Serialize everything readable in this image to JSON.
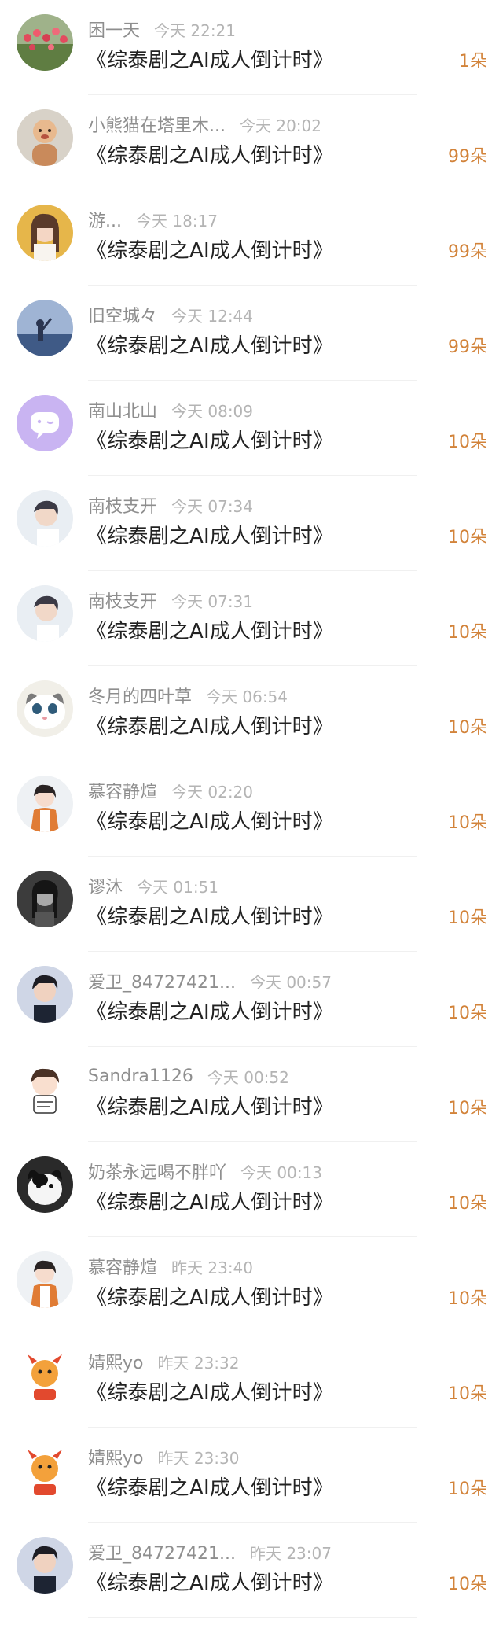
{
  "colors": {
    "name": "#8e8e8e",
    "time": "#b4b4b4",
    "title": "#222222",
    "count": "#d2833a",
    "divider": "#f0f0f0"
  },
  "rows": [
    {
      "name": "困一天",
      "time": "今天 22:21",
      "title": "《综泰剧之AI成人倒计时》",
      "count": "1朵",
      "avatar": "flowers-avatar"
    },
    {
      "name": "小熊猫在塔里木...",
      "time": "今天 20:02",
      "title": "《综泰剧之AI成人倒计时》",
      "count": "99朵",
      "avatar": "child-avatar"
    },
    {
      "name": "游...",
      "time": "今天 18:17",
      "title": "《综泰剧之AI成人倒计时》",
      "count": "99朵",
      "avatar": "girl-avatar"
    },
    {
      "name": "旧空城々",
      "time": "今天 12:44",
      "title": "《综泰剧之AI成人倒计时》",
      "count": "99朵",
      "avatar": "sky-avatar"
    },
    {
      "name": "南山北山",
      "time": "今天 08:09",
      "title": "《综泰剧之AI成人倒计时》",
      "count": "10朵",
      "avatar": "default-avatar"
    },
    {
      "name": "南枝支开",
      "time": "今天 07:34",
      "title": "《综泰剧之AI成人倒计时》",
      "count": "10朵",
      "avatar": "man-avatar"
    },
    {
      "name": "南枝支开",
      "time": "今天 07:31",
      "title": "《综泰剧之AI成人倒计时》",
      "count": "10朵",
      "avatar": "man-avatar"
    },
    {
      "name": "冬月的四叶草",
      "time": "今天 06:54",
      "title": "《综泰剧之AI成人倒计时》",
      "count": "10朵",
      "avatar": "cat-avatar"
    },
    {
      "name": "慕容静煊",
      "time": "今天 02:20",
      "title": "《综泰剧之AI成人倒计时》",
      "count": "10朵",
      "avatar": "winter-girl-avatar"
    },
    {
      "name": "谬沐",
      "time": "今天 01:51",
      "title": "《综泰剧之AI成人倒计时》",
      "count": "10朵",
      "avatar": "dark-portrait-avatar"
    },
    {
      "name": "爱卫_84727421...",
      "time": "今天 00:57",
      "title": "《综泰剧之AI成人倒计时》",
      "count": "10朵",
      "avatar": "young-man-avatar"
    },
    {
      "name": "Sandra1126",
      "time": "今天 00:52",
      "title": "《综泰剧之AI成人倒计时》",
      "count": "10朵",
      "avatar": "cartoon-boy-avatar"
    },
    {
      "name": "奶茶永远喝不胖吖",
      "time": "今天 00:13",
      "title": "《综泰剧之AI成人倒计时》",
      "count": "10朵",
      "avatar": "black-white-cat-avatar"
    },
    {
      "name": "慕容静煊",
      "time": "昨天 23:40",
      "title": "《综泰剧之AI成人倒计时》",
      "count": "10朵",
      "avatar": "winter-girl-avatar"
    },
    {
      "name": "婧熙yo",
      "time": "昨天 23:32",
      "title": "《综泰剧之AI成人倒计时》",
      "count": "10朵",
      "avatar": "dragon-avatar"
    },
    {
      "name": "婧熙yo",
      "time": "昨天 23:30",
      "title": "《综泰剧之AI成人倒计时》",
      "count": "10朵",
      "avatar": "dragon-avatar"
    },
    {
      "name": "爱卫_84727421...",
      "time": "昨天 23:07",
      "title": "《综泰剧之AI成人倒计时》",
      "count": "10朵",
      "avatar": "young-man-avatar"
    }
  ]
}
